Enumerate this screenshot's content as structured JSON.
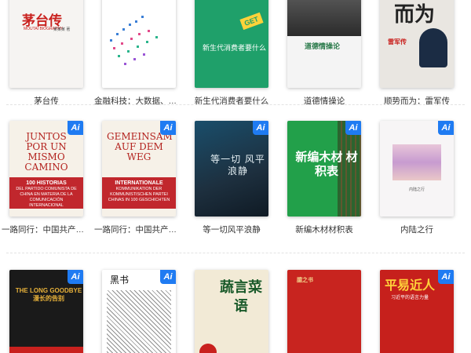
{
  "books": [
    [
      {
        "title": "茅台传",
        "cover": {
          "text": "茅台传",
          "sub": "MOUTAI BIOGRAPHY",
          "author": "某某某 著"
        },
        "ai": false
      },
      {
        "title": "金融科技：大数据、区…",
        "cover": {
          "text": ""
        },
        "ai": false
      },
      {
        "title": "新生代消费者要什么",
        "cover": {
          "text": "新生代消费者要什么",
          "tag": "GET"
        },
        "ai": false
      },
      {
        "title": "道德情操论",
        "cover": {
          "text": "道德情操论"
        },
        "ai": false
      },
      {
        "title": "顺势而为：雷军传",
        "cover": {
          "text": "而为",
          "sub": "雷军传"
        },
        "ai": false
      }
    ],
    [
      {
        "title": "一路同行：中国共产党…",
        "cover": {
          "text": "JUNTOS POR UN MISMO CAMINO",
          "band_title": "100 HISTORIAS",
          "band": "DEL PARTIDO COMUNISTA DE CHINA EN MATERIA DE LA COMUNICACIÓN INTERNACIONAL"
        },
        "ai": true
      },
      {
        "title": "一路同行：中国共产党…",
        "cover": {
          "text": "GEMEINSAM AUF DEM WEG",
          "band_title": "INTERNATIONALE",
          "band": "KOMMUNIKATION DER KOMMUNISTISCHEN PARTEI CHINAS IN 100 GESCHICHTEN"
        },
        "ai": true
      },
      {
        "title": "等一切风平浪静",
        "cover": {
          "text": "等一切 风平浪静"
        },
        "ai": true
      },
      {
        "title": "新编木材材积表",
        "cover": {
          "text": "新编木材 材积表"
        },
        "ai": true
      },
      {
        "title": "内陆之行",
        "cover": {
          "text": "内陆之行"
        },
        "ai": true
      }
    ],
    [
      {
        "title": "",
        "cover": {
          "text": "THE LONG GOODBYE 漫长的告别"
        },
        "ai": true
      },
      {
        "title": "",
        "cover": {
          "text": "黑书"
        },
        "ai": true
      },
      {
        "title": "",
        "cover": {
          "text": "蔬言菜语"
        },
        "ai": false
      },
      {
        "title": "",
        "cover": {
          "text": "臆之书"
        },
        "ai": false
      },
      {
        "title": "",
        "cover": {
          "text": "平易近人",
          "sub": "习近平的语言力量"
        },
        "ai": true
      }
    ]
  ],
  "badge_label": "Ai",
  "colors": {
    "badge": "#1f7bf2",
    "divider": "#e3e3e3"
  }
}
